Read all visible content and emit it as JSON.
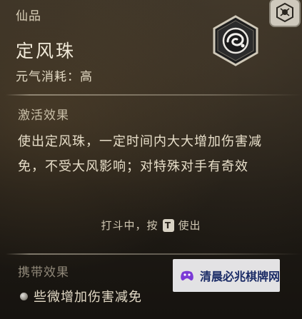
{
  "header": {
    "category": "仙品",
    "item_name": "定风珠",
    "cost": "元气消耗：高",
    "item_icon": "wind-pearl-icon",
    "corner_icon": "hexagon-emblem-icon"
  },
  "effect": {
    "title": "激活效果",
    "description": "使出定风珠，一定时间内大大增加伤害减免，不受大风影响；对特殊对手有奇效",
    "hint_prefix": "打斗中，按",
    "hint_key": "T",
    "hint_suffix": "使出"
  },
  "carry": {
    "title": "携带效果",
    "items": [
      {
        "text": "些微增加伤害减免"
      }
    ]
  },
  "watermark": {
    "text": "清晨必兆棋牌网",
    "logo_icon": "purple-gamepad-logo-icon"
  },
  "colors": {
    "text_primary": "#e8dfca",
    "text_dim": "#8f8778",
    "watermark_text": "#1a2b66",
    "watermark_logo": "#7b3ad6"
  }
}
